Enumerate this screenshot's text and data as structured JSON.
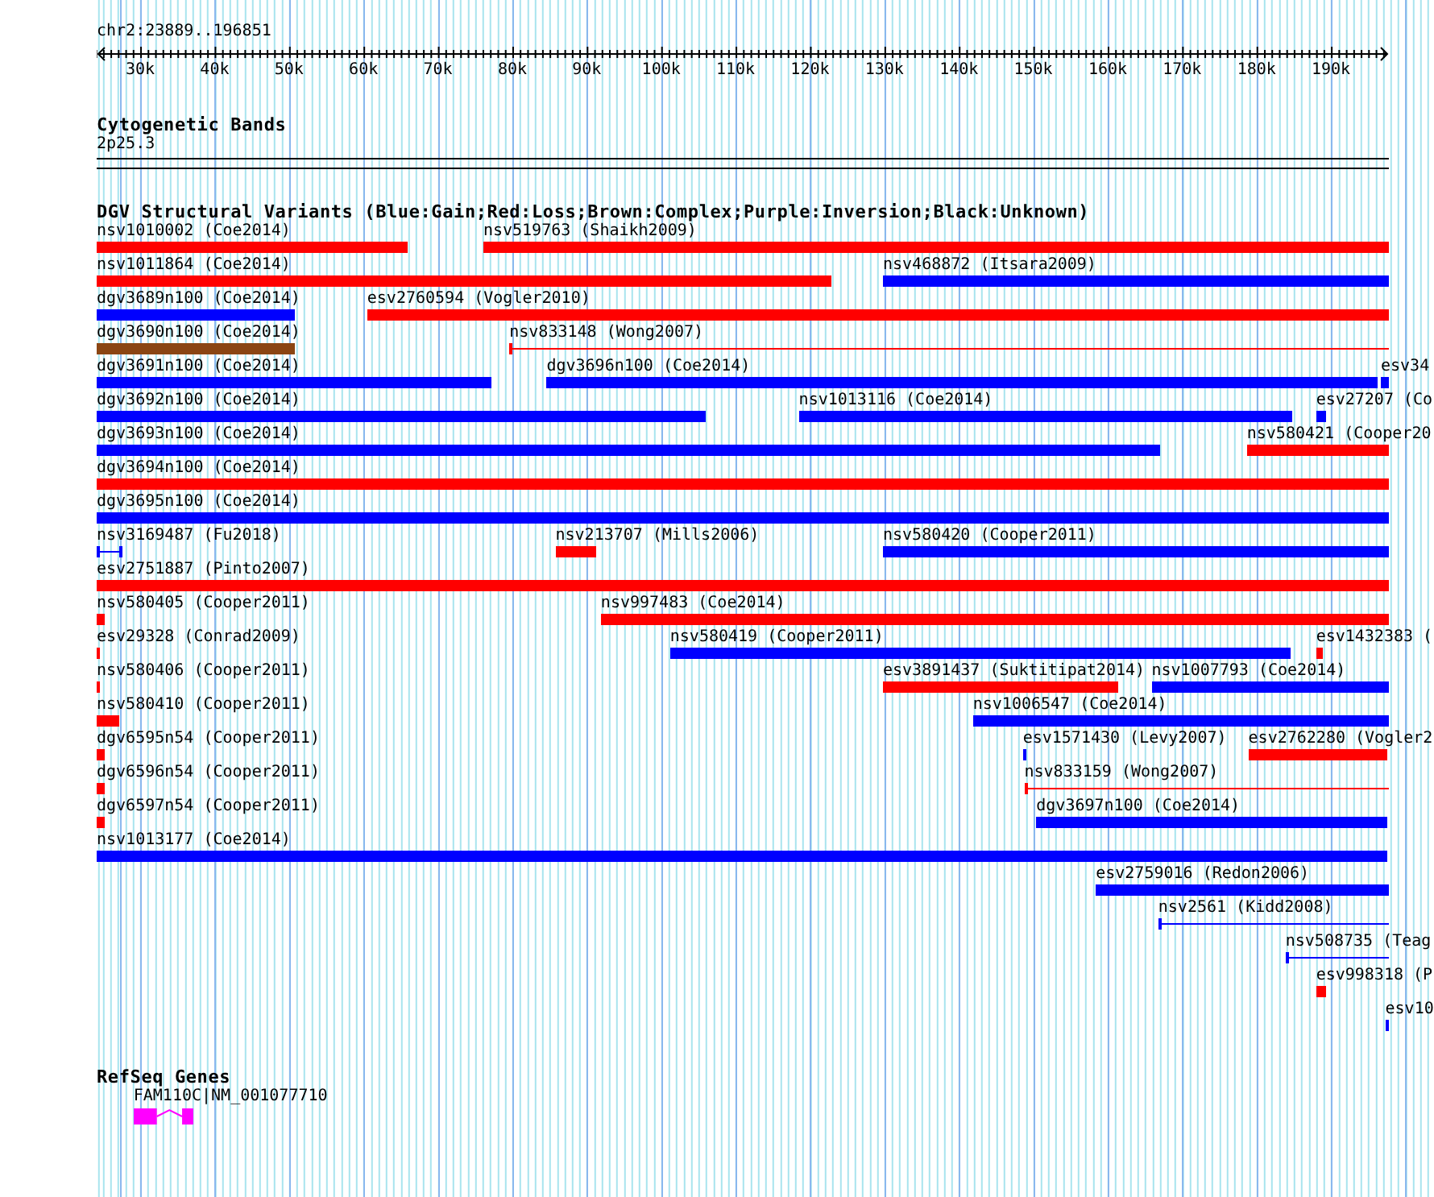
{
  "ruler": {
    "location": "chr2:23889..196851",
    "ticks": [
      {
        "label": "30k"
      },
      {
        "label": "40k"
      },
      {
        "label": "50k"
      },
      {
        "label": "60k"
      },
      {
        "label": "70k"
      },
      {
        "label": "80k"
      },
      {
        "label": "90k"
      },
      {
        "label": "100k"
      },
      {
        "label": "110k"
      },
      {
        "label": "120k"
      },
      {
        "label": "130k"
      },
      {
        "label": "140k"
      },
      {
        "label": "150k"
      },
      {
        "label": "160k"
      },
      {
        "label": "170k"
      },
      {
        "label": "180k"
      },
      {
        "label": "190k"
      }
    ]
  },
  "cytogenetic_bands": {
    "title": "Cytogenetic Bands",
    "band": "2p25.3"
  },
  "dgv_track": {
    "title": "DGV Structural Variants (Blue:Gain;Red:Loss;Brown:Complex;Purple:Inversion;Black:Unknown)",
    "rows": [
      {
        "features": [
          {
            "label": "nsv1010002 (Coe2014)",
            "color": "#ff0000",
            "kind": "bar"
          },
          {
            "label": "nsv519763 (Shaikh2009)",
            "color": "#ff0000",
            "kind": "bar"
          }
        ]
      },
      {
        "features": [
          {
            "label": "nsv1011864 (Coe2014)",
            "color": "#ff0000",
            "kind": "bar"
          },
          {
            "label": "nsv468872 (Itsara2009)",
            "color": "#0000ff",
            "kind": "bar"
          }
        ]
      },
      {
        "features": [
          {
            "label": "dgv3689n100 (Coe2014)",
            "color": "#0000ff",
            "kind": "bar"
          },
          {
            "label": "esv2760594 (Vogler2010)",
            "color": "#ff0000",
            "kind": "bar"
          }
        ]
      },
      {
        "features": [
          {
            "label": "dgv3690n100 (Coe2014)",
            "color": "#8b4513",
            "kind": "bar"
          },
          {
            "label": "nsv833148 (Wong2007)",
            "color": "#ff0000",
            "kind": "line"
          }
        ]
      },
      {
        "features": [
          {
            "label": "dgv3691n100 (Coe2014)",
            "color": "#0000ff",
            "kind": "bar"
          },
          {
            "label": "dgv3696n100 (Coe2014)",
            "color": "#0000ff",
            "kind": "bar"
          },
          {
            "label": "esv34",
            "color": "#0000ff",
            "kind": "bar"
          }
        ]
      },
      {
        "features": [
          {
            "label": "dgv3692n100 (Coe2014)",
            "color": "#0000ff",
            "kind": "bar"
          },
          {
            "label": "nsv1013116 (Coe2014)",
            "color": "#0000ff",
            "kind": "bar"
          },
          {
            "label": "esv27207 (Co",
            "color": "#0000ff",
            "kind": "bar"
          }
        ]
      },
      {
        "features": [
          {
            "label": "dgv3693n100 (Coe2014)",
            "color": "#0000ff",
            "kind": "bar"
          },
          {
            "label": "nsv580421 (Cooper20",
            "color": "#ff0000",
            "kind": "bar"
          }
        ]
      },
      {
        "features": [
          {
            "label": "dgv3694n100 (Coe2014)",
            "color": "#ff0000",
            "kind": "bar"
          }
        ]
      },
      {
        "features": [
          {
            "label": "dgv3695n100 (Coe2014)",
            "color": "#0000ff",
            "kind": "bar"
          }
        ]
      },
      {
        "features": [
          {
            "label": "nsv3169487 (Fu2018)",
            "color": "#0000ff",
            "kind": "line"
          },
          {
            "label": "nsv213707 (Mills2006)",
            "color": "#ff0000",
            "kind": "bar"
          },
          {
            "label": "nsv580420 (Cooper2011)",
            "color": "#0000ff",
            "kind": "bar"
          }
        ]
      },
      {
        "features": [
          {
            "label": "esv2751887 (Pinto2007)",
            "color": "#ff0000",
            "kind": "bar"
          }
        ]
      },
      {
        "features": [
          {
            "label": "nsv580405 (Cooper2011)",
            "color": "#ff0000",
            "kind": "bar"
          },
          {
            "label": "nsv997483 (Coe2014)",
            "color": "#ff0000",
            "kind": "bar"
          }
        ]
      },
      {
        "features": [
          {
            "label": "esv29328 (Conrad2009)",
            "color": "#ff0000",
            "kind": "bar"
          },
          {
            "label": "nsv580419 (Cooper2011)",
            "color": "#0000ff",
            "kind": "bar"
          },
          {
            "label": "esv1432383 (",
            "color": "#ff0000",
            "kind": "bar"
          }
        ]
      },
      {
        "features": [
          {
            "label": "nsv580406 (Cooper2011)",
            "color": "#ff0000",
            "kind": "bar"
          },
          {
            "label": "esv3891437 (Suktitipat2014)",
            "color": "#ff0000",
            "kind": "bar"
          },
          {
            "label": "nsv1007793 (Coe2014)",
            "color": "#0000ff",
            "kind": "bar"
          }
        ]
      },
      {
        "features": [
          {
            "label": "nsv580410 (Cooper2011)",
            "color": "#ff0000",
            "kind": "bar"
          },
          {
            "label": "nsv1006547 (Coe2014)",
            "color": "#0000ff",
            "kind": "bar"
          }
        ]
      },
      {
        "features": [
          {
            "label": "dgv6595n54 (Cooper2011)",
            "color": "#ff0000",
            "kind": "bar"
          },
          {
            "label": "esv1571430 (Levy2007)",
            "color": "#0000ff",
            "kind": "bar"
          },
          {
            "label": "esv2762280 (Vogler2",
            "color": "#ff0000",
            "kind": "bar"
          }
        ]
      },
      {
        "features": [
          {
            "label": "dgv6596n54 (Cooper2011)",
            "color": "#ff0000",
            "kind": "bar"
          },
          {
            "label": "nsv833159 (Wong2007)",
            "color": "#ff0000",
            "kind": "line"
          }
        ]
      },
      {
        "features": [
          {
            "label": "dgv6597n54 (Cooper2011)",
            "color": "#ff0000",
            "kind": "bar"
          },
          {
            "label": "dgv3697n100 (Coe2014)",
            "color": "#0000ff",
            "kind": "bar"
          }
        ]
      },
      {
        "features": [
          {
            "label": "nsv1013177 (Coe2014)",
            "color": "#0000ff",
            "kind": "bar"
          }
        ]
      },
      {
        "features": [
          {
            "label": "esv2759016 (Redon2006)",
            "color": "#0000ff",
            "kind": "bar"
          }
        ]
      },
      {
        "features": [
          {
            "label": "nsv2561 (Kidd2008)",
            "color": "#0000ff",
            "kind": "line"
          }
        ]
      },
      {
        "features": [
          {
            "label": "nsv508735 (Teag",
            "color": "#0000ff",
            "kind": "line"
          }
        ]
      },
      {
        "features": [
          {
            "label": "esv998318 (P",
            "color": "#ff0000",
            "kind": "bar"
          }
        ]
      },
      {
        "features": [
          {
            "label": "esv10",
            "color": "#0000ff",
            "kind": "bar"
          }
        ]
      }
    ]
  },
  "refseq_track": {
    "title": "RefSeq Genes",
    "genes": [
      {
        "label": "FAM110C|NM_001077710"
      }
    ]
  }
}
